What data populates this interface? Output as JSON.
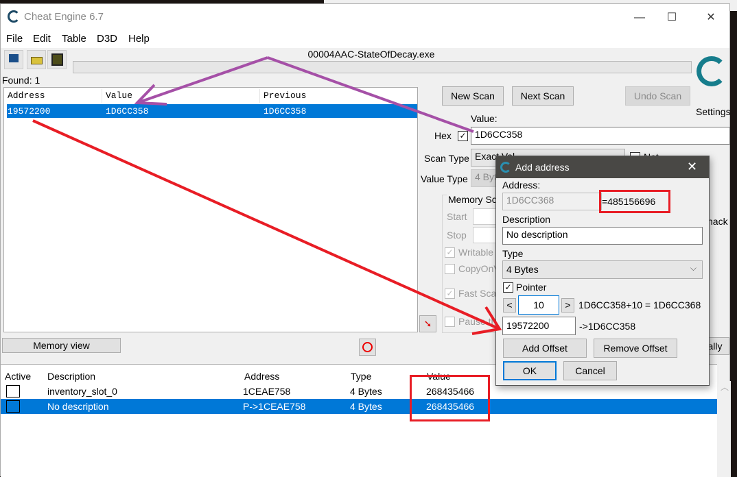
{
  "window": {
    "title": "Cheat Engine 6.7",
    "process_name": "00004AAC-StateOfDecay.exe",
    "controls": {
      "minimize": "—",
      "maximize": "☐",
      "close": "✕"
    }
  },
  "menu": [
    "File",
    "Edit",
    "Table",
    "D3D",
    "Help"
  ],
  "toolbar": {
    "icons": [
      "select-process-icon",
      "open-file-icon",
      "save-icon"
    ]
  },
  "scan": {
    "found_label": "Found: 1",
    "results_columns": [
      "Address",
      "Value",
      "Previous"
    ],
    "results_rows": [
      {
        "address": "19572200",
        "value": "1D6CC358",
        "previous": "1D6CC358",
        "selected": true
      }
    ],
    "new_scan": "New Scan",
    "next_scan": "Next Scan",
    "undo_scan": "Undo Scan",
    "settings": "Settings",
    "value_label": "Value:",
    "hex_label": "Hex",
    "hex_checked": true,
    "value_input": "1D6CC358",
    "scan_type_label": "Scan Type",
    "scan_type_value": "Exact Val",
    "not_label": "Not",
    "value_type_label": "Value Type",
    "value_type_value": "4 Byt",
    "memory_scan_label": "Memory Sc",
    "start_label": "Start",
    "stop_label": "Stop",
    "writable_label": "Writable",
    "copyonwrite_label": "CopyOnV",
    "fast_scan_label": "Fast Scan",
    "pause_label": "Pause th",
    "speedhack_label": "hack",
    "add_manually_label": "ally"
  },
  "memory_view_button": "Memory view",
  "address_table": {
    "columns": [
      "Active",
      "Description",
      "Address",
      "Type",
      "Value"
    ],
    "rows": [
      {
        "active": false,
        "description": "inventory_slot_0",
        "address": "1CEAE758",
        "type": "4 Bytes",
        "value": "268435466",
        "selected": false
      },
      {
        "active": false,
        "description": "No description",
        "address": "P->1CEAE758",
        "type": "4 Bytes",
        "value": "268435466",
        "selected": true
      }
    ]
  },
  "dialog": {
    "title": "Add address",
    "address_label": "Address:",
    "address_value": "1D6CC368",
    "address_decimal": "=485156696",
    "description_label": "Description",
    "description_value": "No description",
    "type_label": "Type",
    "type_value": "4 Bytes",
    "pointer_label": "Pointer",
    "pointer_checked": true,
    "offset_prev": "<",
    "offset_value": "10",
    "offset_next": ">",
    "offset_calc": "1D6CC358+10 = 1D6CC368",
    "base_address": "19572200",
    "base_resolves": "->1D6CC358",
    "add_offset": "Add Offset",
    "remove_offset": "Remove Offset",
    "ok": "OK",
    "cancel": "Cancel"
  },
  "annotation_colors": {
    "purple_arrow": "#a550a7",
    "red_arrow": "#e81d25",
    "highlight_box": "#e81d25"
  }
}
